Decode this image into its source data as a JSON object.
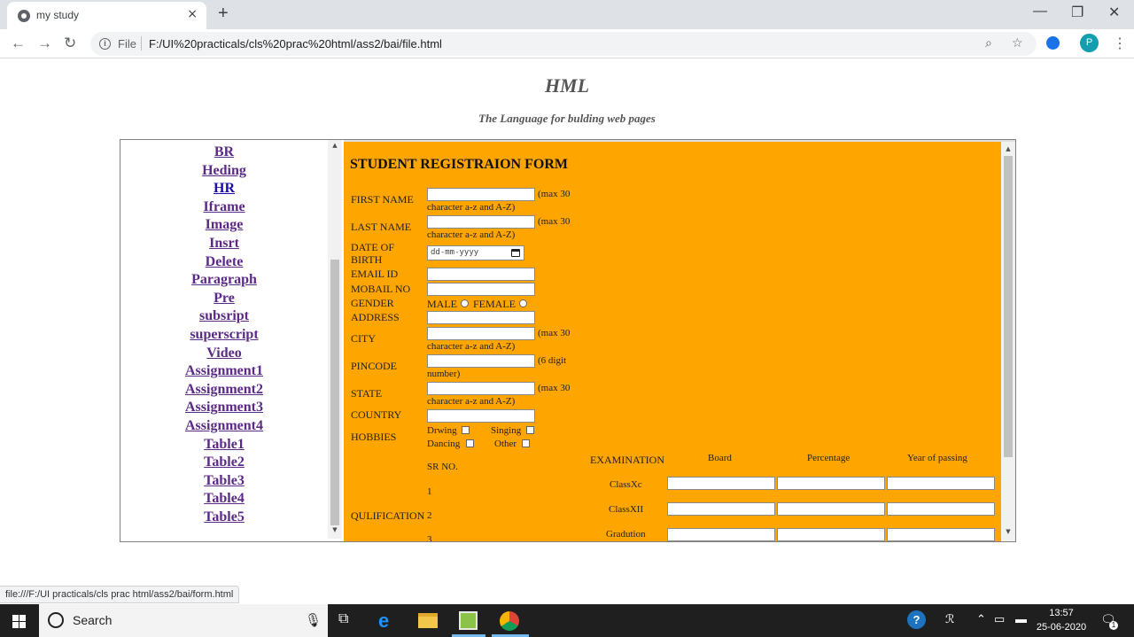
{
  "browser": {
    "tab_title": "my study",
    "tab_close": "×",
    "new_tab": "+",
    "scheme": "File",
    "url": "F:/UI%20practicals/cls%20prac%20html/ass2/bai/file.html",
    "profile_initial": "P",
    "status_url": "file:///F:/UI practicals/cls prac html/ass2/bai/form.html"
  },
  "page": {
    "title": "HML",
    "subtitle": "The Language for bulding web pages"
  },
  "nav_links": [
    {
      "label": "BR",
      "visited": true
    },
    {
      "label": "Heding",
      "visited": true
    },
    {
      "label": "HR",
      "visited": false
    },
    {
      "label": "Iframe",
      "visited": true
    },
    {
      "label": "Image",
      "visited": true
    },
    {
      "label": "Insrt",
      "visited": true
    },
    {
      "label": "Delete",
      "visited": true
    },
    {
      "label": "Paragraph",
      "visited": true
    },
    {
      "label": "Pre",
      "visited": true
    },
    {
      "label": "subsript",
      "visited": true
    },
    {
      "label": "superscript",
      "visited": true
    },
    {
      "label": "Video",
      "visited": true
    },
    {
      "label": "Assignment1",
      "visited": true
    },
    {
      "label": "Assignment2",
      "visited": true
    },
    {
      "label": "Assignment3",
      "visited": true
    },
    {
      "label": "Assignment4",
      "visited": true
    },
    {
      "label": "Table1",
      "visited": true
    },
    {
      "label": "Table2",
      "visited": true
    },
    {
      "label": "Table3",
      "visited": true
    },
    {
      "label": "Table4",
      "visited": true
    },
    {
      "label": "Table5",
      "visited": true
    }
  ],
  "form": {
    "title": "STUDENT REGISTRAION FORM",
    "first_name": {
      "label": "FIRST NAME",
      "hint_a": "(max 30",
      "hint_b": "character a-z and A-Z)"
    },
    "last_name": {
      "label": "LAST NAME",
      "hint_a": "(max 30",
      "hint_b": "character a-z and A-Z)"
    },
    "dob": {
      "label_a": "DATE OF",
      "label_b": "BIRTH",
      "placeholder": "dd-mm-yyyy"
    },
    "email": {
      "label": "EMAIL ID"
    },
    "mobile": {
      "label": "MOBAIL NO"
    },
    "gender": {
      "label": "GENDER",
      "male": "MALE",
      "female": "FEMALE"
    },
    "address": {
      "label": "ADDRESS"
    },
    "city": {
      "label": "CITY",
      "hint_a": "(max 30",
      "hint_b": "character a-z and A-Z)"
    },
    "pincode": {
      "label": "PINCODE",
      "hint_a": "(6 digit",
      "hint_b": "number)"
    },
    "state": {
      "label": "STATE",
      "hint_a": "(max 30",
      "hint_b": "character a-z and A-Z)"
    },
    "country": {
      "label": "COUNTRY"
    },
    "hobbies": {
      "label": "HOBBIES",
      "items": [
        "Drwing",
        "Singing",
        "Dancing",
        "Other"
      ]
    },
    "qualification": {
      "label": "QULIFICATION",
      "sr_header": "SR NO.",
      "exam_header": "EXAMINATION",
      "columns": [
        "Board",
        "Percentage",
        "Year of passing"
      ],
      "rows": [
        {
          "sr": "1",
          "exam": "ClassXc"
        },
        {
          "sr": "2",
          "exam": "ClassXII"
        },
        {
          "sr": "3",
          "exam": "Gradution"
        }
      ]
    }
  },
  "taskbar": {
    "search_text": "Search",
    "time": "13:57",
    "date": "25-06-2020",
    "notification_count": "1"
  },
  "colors": {
    "form_background": "#ffa500",
    "link_visited": "#5b2a86",
    "link_unvisited": "#1a0dab"
  }
}
